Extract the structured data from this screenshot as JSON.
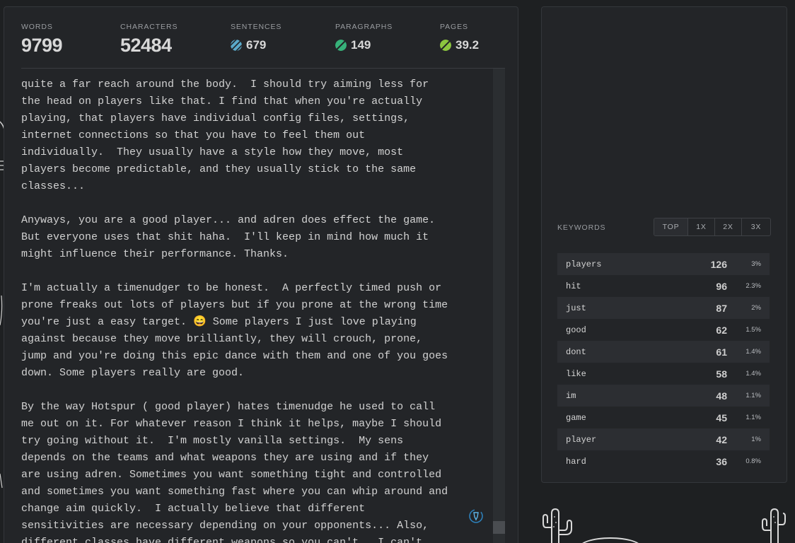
{
  "stats": {
    "words": {
      "label": "WORDS",
      "value": "9799"
    },
    "characters": {
      "label": "CHARACTERS",
      "value": "52484"
    },
    "sentences": {
      "label": "SENTENCES",
      "value": "679",
      "color": "#5aa9c9"
    },
    "paragraphs": {
      "label": "PARAGRAPHS",
      "value": "149",
      "color": "#37b27a"
    },
    "pages": {
      "label": "PAGES",
      "value": "39.2",
      "color": "#8cc63f"
    }
  },
  "editor": {
    "text": "quite a far reach around the body.  I should try aiming less for\nthe head on players like that. I find that when you're actually\nplaying, that players have individual config files, settings,\ninternet connections so that you have to feel them out\nindividually.  They usually have a style how they move, most\nplayers become predictable, and they usually stick to the same\nclasses...\n\nAnyways, you are a good player... and adren does effect the game.\nBut everyone uses that shit haha.  I'll keep in mind how much it\nmight influence their performance. Thanks.\n\nI'm actually a timenudger to be honest.  A perfectly timed push or\nprone freaks out lots of players but if you prone at the wrong time\nyou're just a easy target. 😄 Some players I just love playing\nagainst because they move brilliantly, they will crouch, prone,\njump and you're doing this epic dance with them and one of you goes\ndown. Some players really are good.\n\nBy the way Hotspur ( good player) hates timenudge he used to call\nme out on it. For whatever reason I think it helps, maybe I should\ntry going without it.  I'm mostly vanilla settings.  My sens\ndepends on the teams and what weapons they are using and if they\nare using adren. Sometimes you want something tight and controlled\nand sometimes you want something fast where you can whip around and\nchange aim quickly.  I actually believe that different\nsensitivities are necessary depending on your opponents... Also,\ndifferent classes have different weapons so you can't.  I can't"
  },
  "keywords": {
    "label": "KEYWORDS",
    "tabs": [
      "TOP",
      "1X",
      "2X",
      "3X"
    ],
    "active_tab": "TOP",
    "items": [
      {
        "word": "players",
        "count": "126",
        "pct": "3%"
      },
      {
        "word": "hit",
        "count": "96",
        "pct": "2.3%"
      },
      {
        "word": "just",
        "count": "87",
        "pct": "2%"
      },
      {
        "word": "good",
        "count": "62",
        "pct": "1.5%"
      },
      {
        "word": "dont",
        "count": "61",
        "pct": "1.4%"
      },
      {
        "word": "like",
        "count": "58",
        "pct": "1.4%"
      },
      {
        "word": "im",
        "count": "48",
        "pct": "1.1%"
      },
      {
        "word": "game",
        "count": "45",
        "pct": "1.1%"
      },
      {
        "word": "player",
        "count": "42",
        "pct": "1%"
      },
      {
        "word": "hard",
        "count": "36",
        "pct": "0.8%"
      }
    ]
  }
}
